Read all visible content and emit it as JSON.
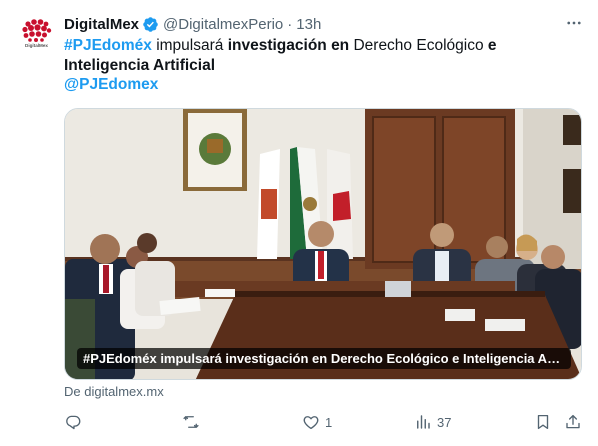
{
  "tweet": {
    "author_name": "DigitalMex",
    "handle": "@DigitalmexPerio",
    "separator": "·",
    "time": "13h",
    "avatar_label": "DigitalMex",
    "text_parts": {
      "hashtag": "#PJEdoméx",
      "p1": " impulsará ",
      "b1": "investigación en",
      "p2": " Derecho Ecológico ",
      "b2": "e Inteligencia Artificial"
    },
    "mention": "@PJEdomex"
  },
  "card": {
    "title": "#PJEdoméx impulsará investigación en Derecho Ecológico e Inteligencia Artificial",
    "source": "De digitalmex.mx"
  },
  "actions": {
    "reply_count": "",
    "retweet_count": "",
    "like_count": "1",
    "views_count": "37"
  },
  "colors": {
    "accent": "#1d9bf0",
    "secondary_text": "#536471",
    "brand_red": "#c8102e"
  },
  "icons": [
    "verified-badge-icon",
    "more-icon",
    "reply-icon",
    "retweet-icon",
    "like-icon",
    "views-icon",
    "bookmark-icon",
    "share-icon"
  ]
}
